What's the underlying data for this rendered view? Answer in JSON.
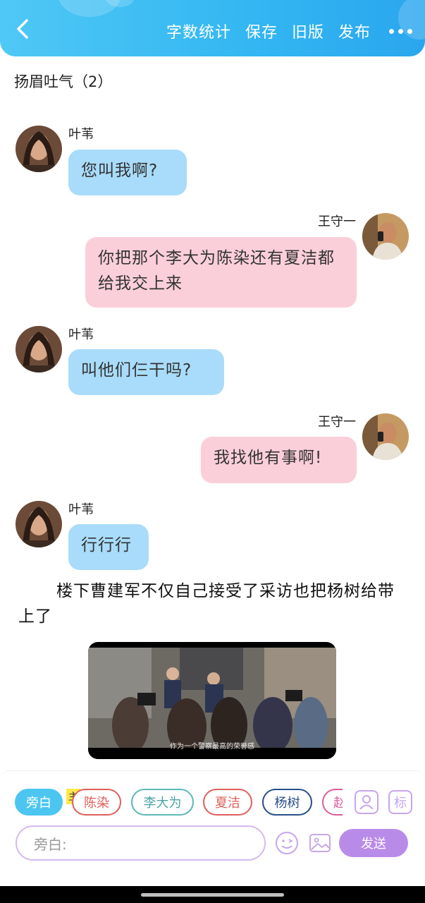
{
  "header": {
    "menu": [
      "字数统计",
      "保存",
      "旧版",
      "发布"
    ]
  },
  "chapter_title": "扬眉吐气（2）",
  "messages": [
    {
      "speaker": "叶苇",
      "text": "您叫我啊?"
    },
    {
      "speaker": "王守一",
      "text": "你把那个李大为陈染还有夏洁都给我交上来"
    },
    {
      "speaker": "叶苇",
      "text": "叫他们仨干吗?"
    },
    {
      "speaker": "王守一",
      "text": "我找他有事啊!"
    },
    {
      "speaker": "叶苇",
      "text": "行行行"
    }
  ],
  "narration": "楼下曹建军不仅自己接受了采访也把杨树给带上了",
  "video": {
    "subtitle": "作为一个警察最高的荣誉感"
  },
  "characters": {
    "main_tag": "主",
    "chips": [
      "旁白",
      "陈染",
      "李大为",
      "夏洁",
      "杨树",
      "赵"
    ]
  },
  "tool_icons": {
    "profile": "profile-card-icon",
    "mark": "标"
  },
  "composer": {
    "placeholder": "旁白:",
    "send_label": "发送"
  },
  "colors": {
    "header": "#33b6f2",
    "left_bubble": "#a8dcfa",
    "right_bubble": "#fbcfd9",
    "send": "#b98be9"
  }
}
